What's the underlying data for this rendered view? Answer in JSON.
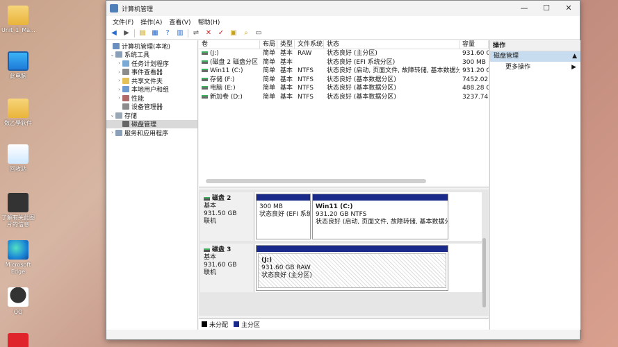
{
  "desktop": {
    "icons": [
      {
        "label": "Unit_1_Ma...",
        "icon": "folder-icon"
      },
      {
        "label": "此电脑",
        "icon": "monitor-icon"
      },
      {
        "label": "数乙學软件",
        "icon": "folder-icon"
      },
      {
        "label": "回收站",
        "icon": "recycle-bin-icon"
      },
      {
        "label": "了解有关此图片的信息",
        "icon": "info-icon"
      },
      {
        "label": "Microsoft Edge",
        "icon": "edge-icon"
      },
      {
        "label": "QQ",
        "icon": "qq-icon"
      }
    ]
  },
  "window": {
    "title": "计算机管理",
    "controls": {
      "minimize": "—",
      "maximize": "☐",
      "close": "✕"
    }
  },
  "menu": [
    "文件(F)",
    "操作(A)",
    "查看(V)",
    "帮助(H)"
  ],
  "tree": {
    "root": "计算机管理(本地)",
    "system_tools": "系统工具",
    "task_scheduler": "任务计划程序",
    "event_viewer": "事件查看器",
    "shared_folders": "共享文件夹",
    "local_users": "本地用户和组",
    "performance": "性能",
    "device_manager": "设备管理器",
    "storage": "存储",
    "disk_management": "磁盘管理",
    "services": "服务和应用程序"
  },
  "volumes": {
    "headers": [
      "卷",
      "布局",
      "类型",
      "文件系统",
      "状态",
      "容量"
    ],
    "rows": [
      [
        "(J:)",
        "简单",
        "基本",
        "RAW",
        "状态良好 (主分区)",
        "931.60 G"
      ],
      [
        "(磁盘 2 磁盘分区 1)",
        "简单",
        "基本",
        "",
        "状态良好 (EFI 系统分区)",
        "300 MB"
      ],
      [
        "Win11 (C:)",
        "简单",
        "基本",
        "NTFS",
        "状态良好 (启动, 页面文件, 故障转储, 基本数据分区)",
        "931.20 G"
      ],
      [
        "存储 (F:)",
        "简单",
        "基本",
        "NTFS",
        "状态良好 (基本数据分区)",
        "7452.02"
      ],
      [
        "电脑 (E:)",
        "简单",
        "基本",
        "NTFS",
        "状态良好 (基本数据分区)",
        "488.28 G"
      ],
      [
        "新加卷 (D:)",
        "简单",
        "基本",
        "NTFS",
        "状态良好 (基本数据分区)",
        "3237.74"
      ]
    ]
  },
  "disks": [
    {
      "name": "磁盘 2",
      "type": "基本",
      "size": "931.50 GB",
      "status": "联机",
      "partitions": [
        {
          "title": "",
          "line1": "300 MB",
          "line2": "状态良好 (EFI 系统分"
        },
        {
          "title": "Win11  (C:)",
          "line1": "931.20 GB NTFS",
          "line2": "状态良好 (启动, 页面文件, 故障转储, 基本数据分区)"
        }
      ]
    },
    {
      "name": "磁盘 3",
      "type": "基本",
      "size": "931.60 GB",
      "status": "联机",
      "partitions": [
        {
          "title": "(J:)",
          "line1": "931.60 GB RAW",
          "line2": "状态良好 (主分区)"
        }
      ]
    }
  ],
  "legend": {
    "unallocated": "未分配",
    "primary": "主分区"
  },
  "colors": {
    "unallocated": "#000000",
    "primary": "#1a2a8a",
    "selection": "#c7dcef"
  },
  "actions": {
    "header": "操作",
    "section": "磁盘管理",
    "more": "更多操作"
  }
}
